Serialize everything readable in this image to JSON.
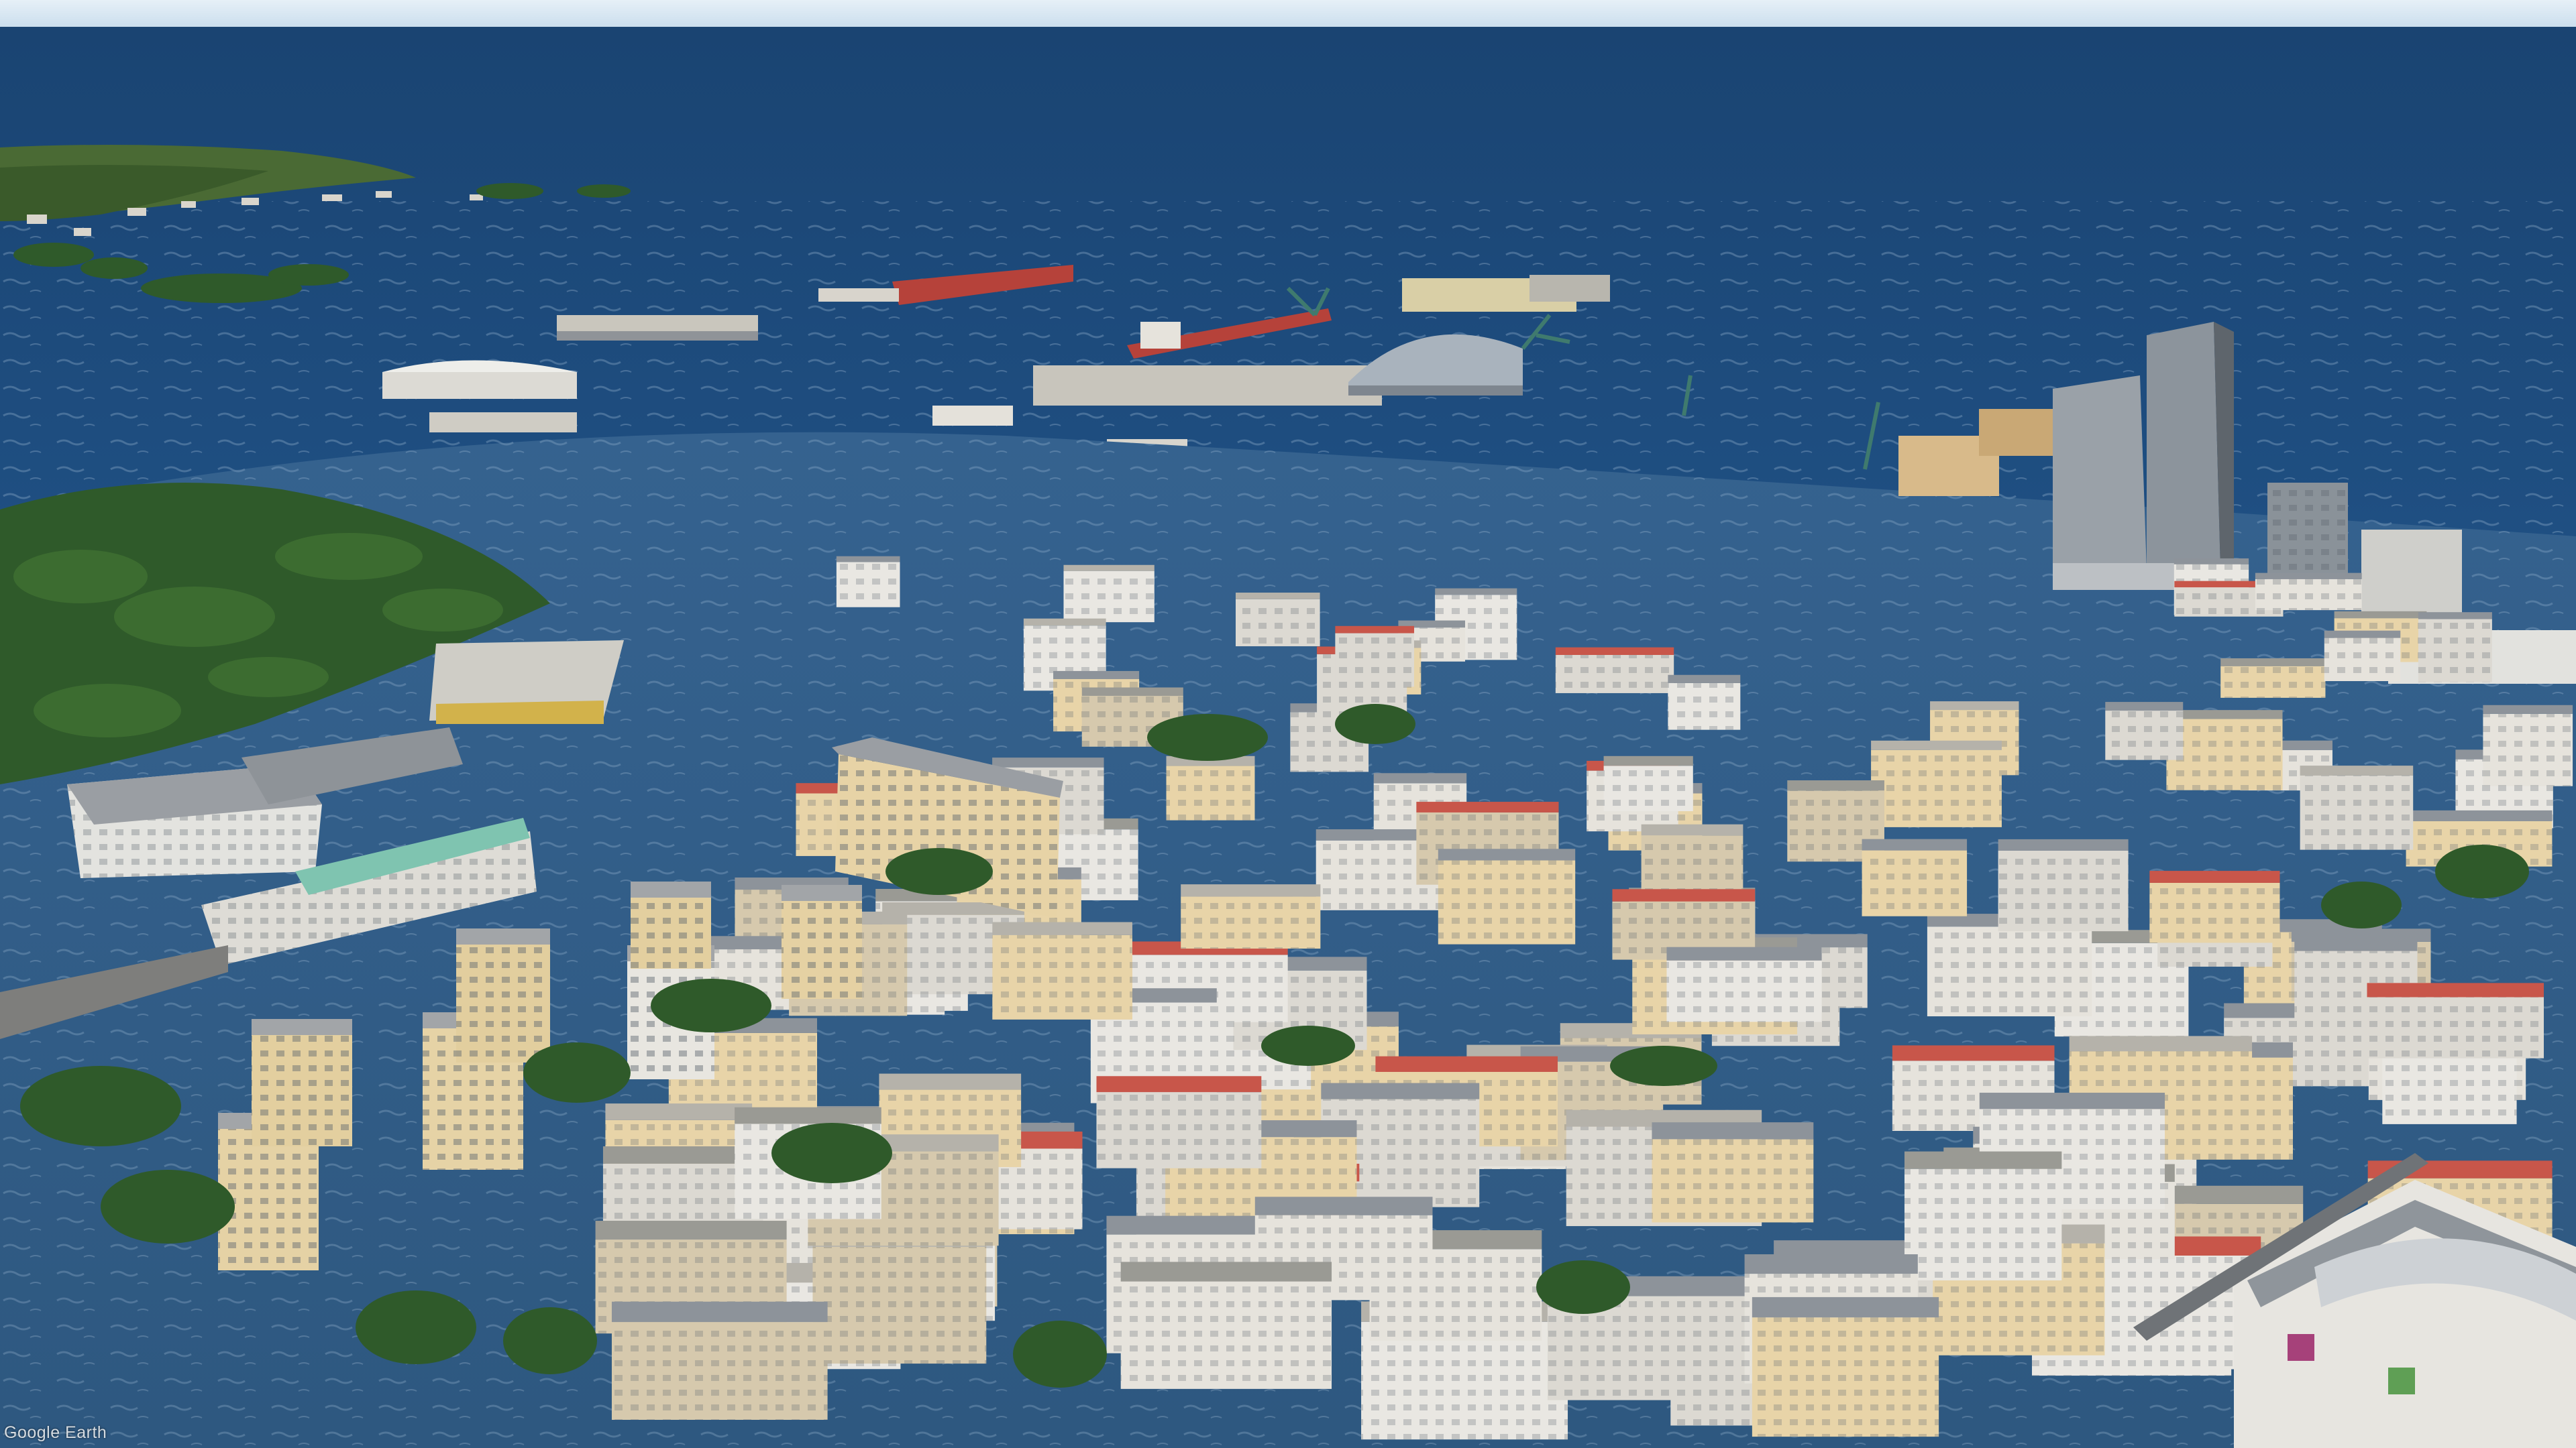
{
  "scene": {
    "kind": "aerial-3d-view",
    "subject": "flooded-coastal-city",
    "colors": {
      "sky": "#dcebf5",
      "sea_far": "#1d4f86",
      "sea_near": "#2b5c8c",
      "flood_water": "#335f8e",
      "wave_foam": "#9fbcd6",
      "trees": "#2f5a2a",
      "building_light": "#e6e3dc",
      "building_shadow": "#9fa6ad",
      "building_cream": "#e8d4a8",
      "roof_red": "#c8564a",
      "roof_gray": "#8d939a"
    }
  },
  "attribution": {
    "text": "Google Earth"
  }
}
